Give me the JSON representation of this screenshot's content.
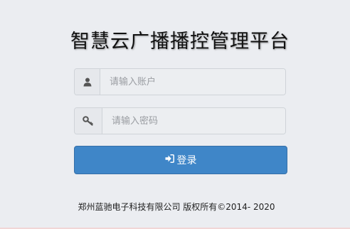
{
  "page": {
    "title": "智慧云广播播控管理平台"
  },
  "form": {
    "username": {
      "placeholder": "请输入账户",
      "value": "",
      "icon": "user-icon"
    },
    "password": {
      "placeholder": "请输入密码",
      "value": "",
      "icon": "key-icon"
    },
    "login_label": "登录",
    "login_icon": "sign-in-icon"
  },
  "footer": {
    "copyright": "郑州蓝驰电子科技有限公司 版权所有©2014- 2020"
  },
  "colors": {
    "background": "#ebedf1",
    "button": "#3f86c8",
    "input_bg": "#eceef1"
  }
}
